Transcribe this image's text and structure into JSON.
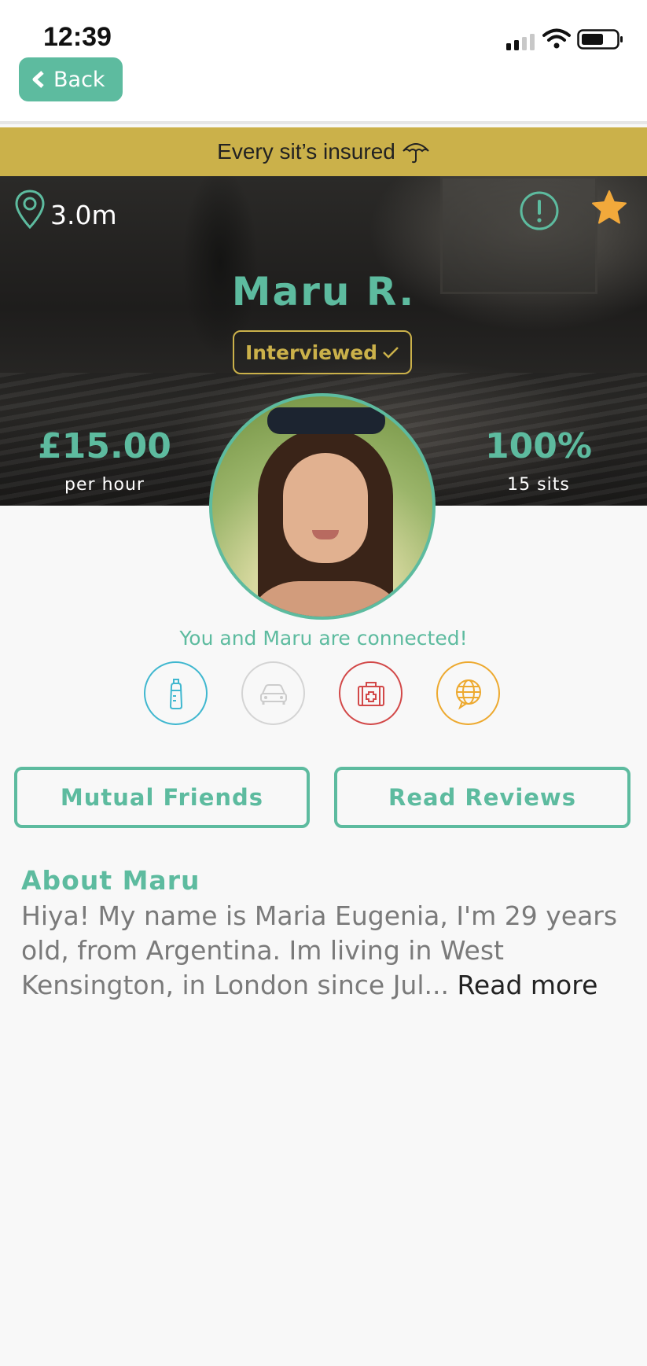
{
  "status_bar": {
    "time": "12:39"
  },
  "nav": {
    "back_label": "Back"
  },
  "banner": {
    "text": "Every sit’s insured",
    "icon": "umbrella-icon"
  },
  "profile": {
    "distance": "3.0m",
    "name": "Maru R.",
    "badge": "Interviewed",
    "price": "£15.00",
    "price_unit": "per hour",
    "rating": "100%",
    "rating_sub": "15 sits",
    "connected_text": "You and Maru are connected!"
  },
  "skills": [
    {
      "icon": "baby-bottle-icon",
      "color": "#3fb7cf",
      "active": true
    },
    {
      "icon": "car-icon",
      "color": "#cccccc",
      "active": false
    },
    {
      "icon": "first-aid-kit-icon",
      "color": "#d24848",
      "active": true
    },
    {
      "icon": "globe-speech-icon",
      "color": "#eda92f",
      "active": true
    }
  ],
  "buttons": {
    "mutual_friends": "Mutual Friends",
    "read_reviews": "Read Reviews"
  },
  "about": {
    "heading": "About Maru",
    "text": "Hiya! My name is Maria Eugenia, I'm 29 years old, from Argentina. Im living in West Kensington, in London since Jul...",
    "read_more": "Read more"
  },
  "colors": {
    "accent": "#5dbb9f",
    "gold": "#cbb14a",
    "star": "#f2a93b"
  }
}
